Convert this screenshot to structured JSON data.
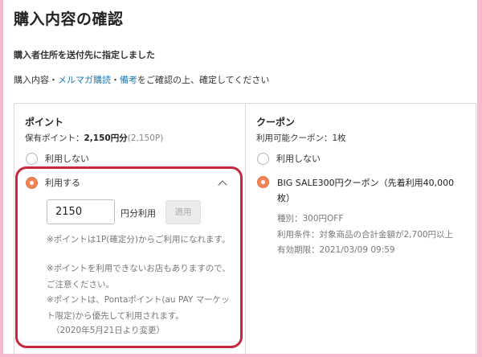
{
  "page": {
    "title": "購入内容の確認",
    "notice": "購入者住所を送付先に指定しました",
    "instructions": {
      "prefix": "購入内容・",
      "link1": "メルマガ購読",
      "sep": "・",
      "link2": "備考",
      "suffix": "をご確認の上、確定してください"
    }
  },
  "points": {
    "heading": "ポイント",
    "held_label": "保有ポイント：",
    "held_value": "2,150円分",
    "held_raw": "(2,150P)",
    "option_no": "利用しない",
    "option_yes": "利用する",
    "selected": "利用する",
    "input_value": "2150",
    "unit": "円分利用",
    "apply_label": "適用",
    "notes": [
      "※ポイントは1P(確定分)からご利用になれます。",
      "※ポイントを利用できないお店もありますので、ご注意ください。",
      "※ポイントは、Pontaポイント(au PAY マーケット限定)から優先して利用されます。",
      "（2020年5月21日より変更）"
    ]
  },
  "coupon": {
    "heading": "クーポン",
    "available": "利用可能クーポン：1枚",
    "option_no": "利用しない",
    "selected_title": "BIG SALE300円クーポン（先着利用40,000枚）",
    "type": "種別：300円OFF",
    "condition": "利用条件：対象商品の合計金額が2,700円以上",
    "expiry": "有効期限：2021/03/09 09:59"
  },
  "colors": {
    "background_frame": "#f4b8cf",
    "accent_radio": "#f08458",
    "highlight_border": "#c8253e",
    "link": "#1a7cb5"
  },
  "icons": {
    "collapse": "chevron-up-icon"
  }
}
